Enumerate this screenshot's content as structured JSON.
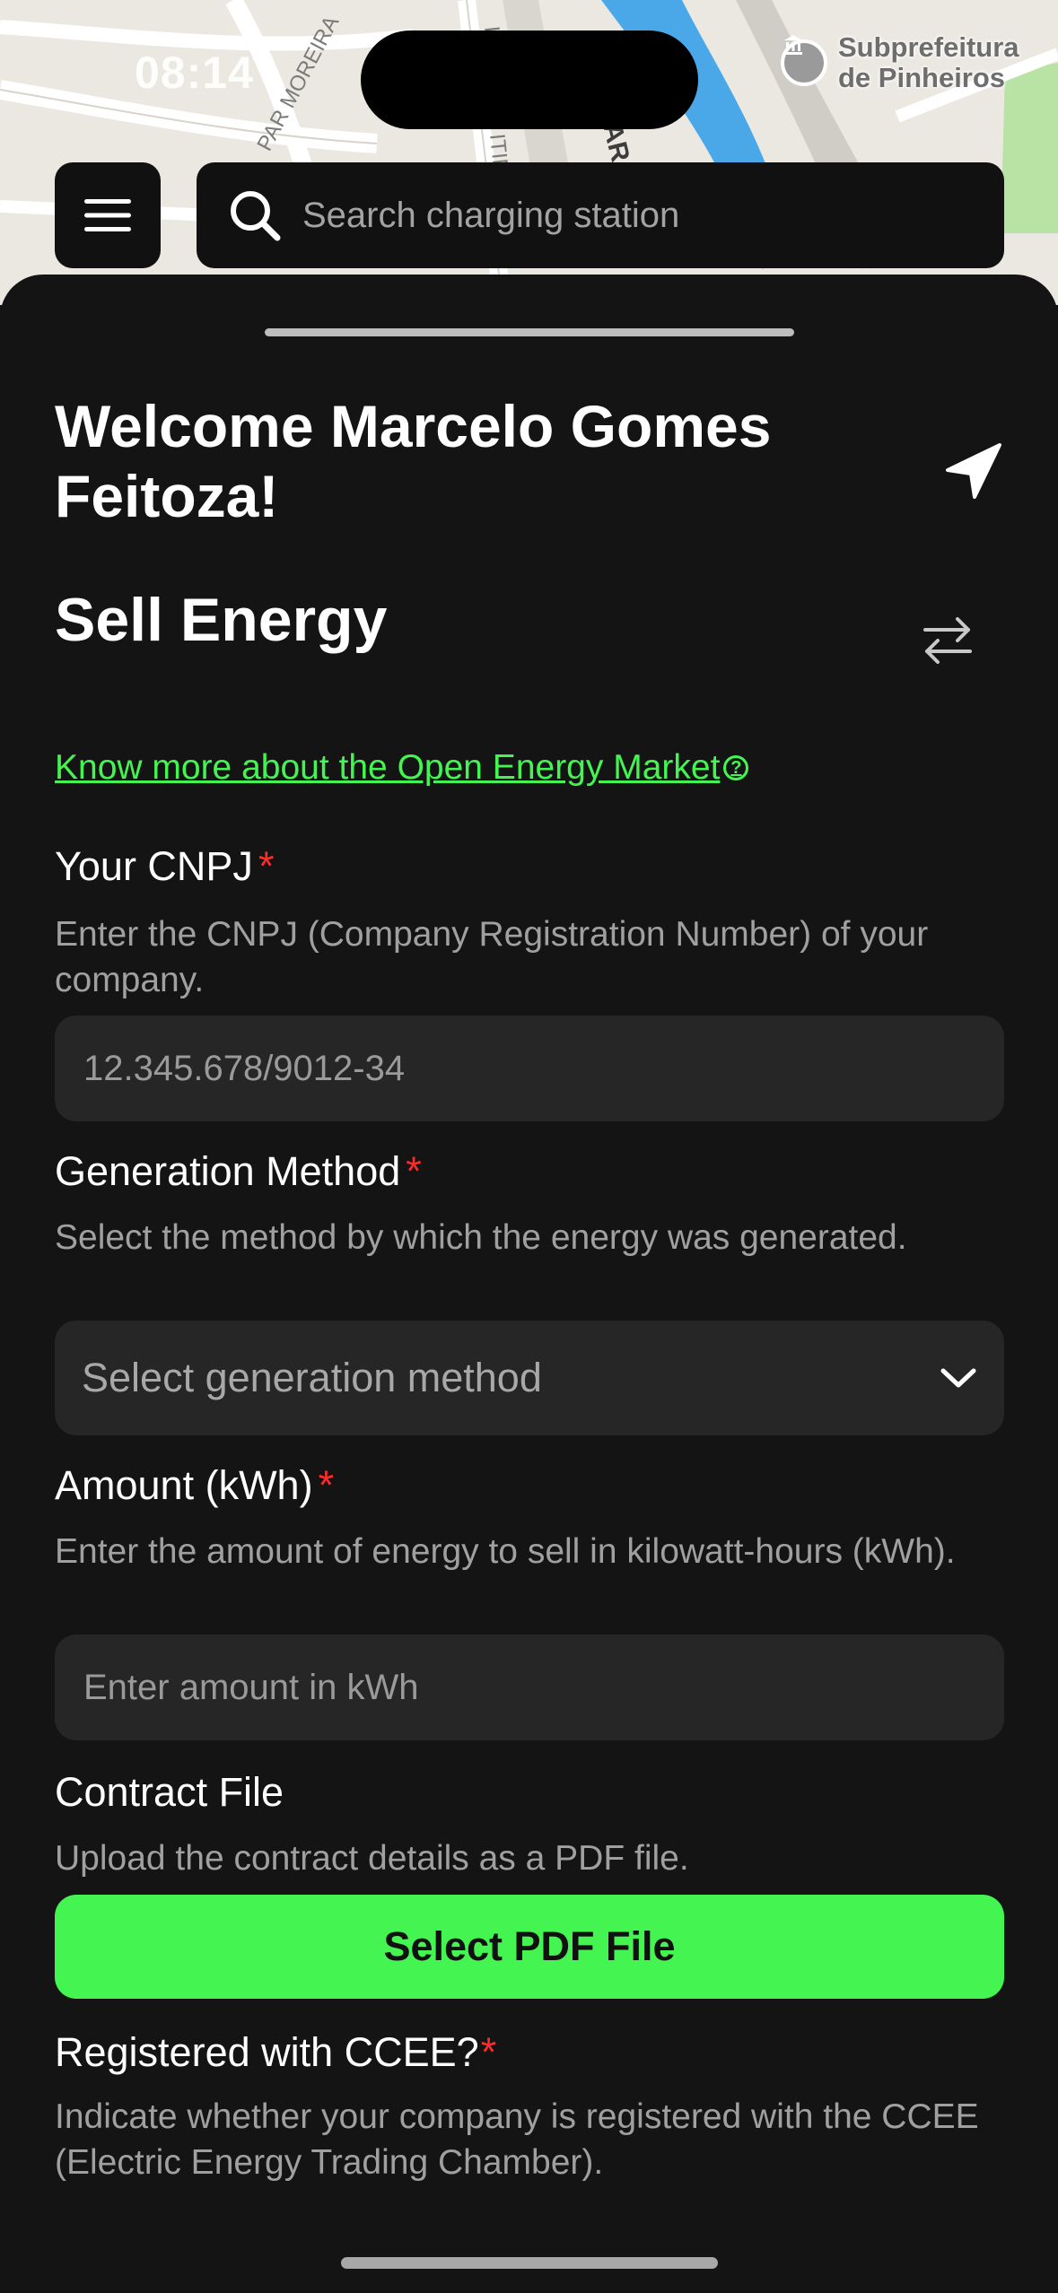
{
  "status": {
    "time": "08:14"
  },
  "map": {
    "poi_label_line1": "Subprefeitura",
    "poi_label_line2": "de Pinheiros",
    "street_labels": [
      "PAR MOREIRA",
      "ID",
      "ITIM",
      "AR"
    ]
  },
  "top_bar": {
    "menu_icon": "hamburger-icon",
    "search_icon": "search-icon",
    "search_placeholder": "Search charging station"
  },
  "sheet": {
    "welcome_title": "Welcome Marcelo Gomes Feitoza!",
    "section_title": "Sell Energy",
    "navigation_icon": "location-arrow-icon",
    "switch_icon": "swap-arrows-icon",
    "market_link": "Know more about the Open Energy Market",
    "help_icon": "?",
    "required_marker": "*",
    "fields": {
      "cnpj": {
        "label": "Your CNPJ",
        "description": "Enter the CNPJ (Company Registration Number) of your company.",
        "placeholder": "12.345.678/9012-34"
      },
      "generation_method": {
        "label": "Generation Method",
        "description": "Select the method by which the energy was generated.",
        "selected_value": "Select generation method"
      },
      "amount": {
        "label": "Amount (kWh)",
        "description": "Enter the amount of energy to sell in kilowatt-hours (kWh).",
        "placeholder": "Enter amount in kWh"
      },
      "contract_file": {
        "label": "Contract File",
        "description": "Upload the contract details as a PDF file.",
        "button_label": "Select PDF File"
      },
      "ccee": {
        "label": "Registered with CCEE?",
        "description": "Indicate whether your company is registered with the CCEE (Electric Energy Trading Chamber)."
      }
    }
  },
  "colors": {
    "accent_green": "#44f552",
    "background": "#141414",
    "field_background": "#262626",
    "required_red": "#ff2a2a",
    "water_blue": "#4aa8e8"
  }
}
